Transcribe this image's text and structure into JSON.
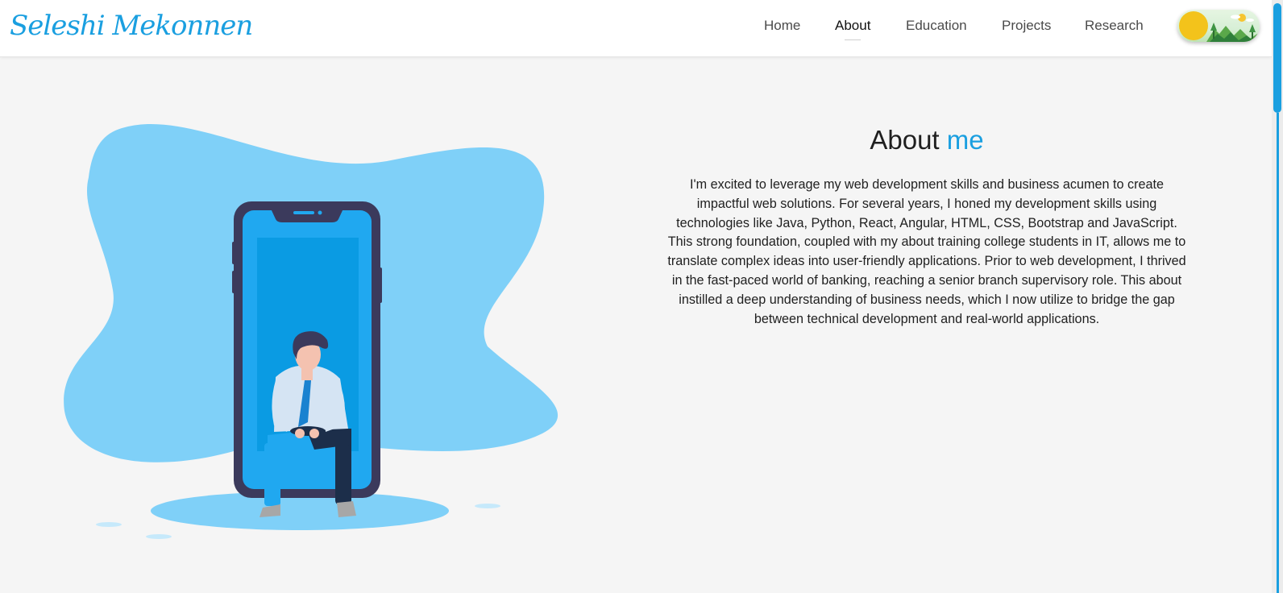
{
  "header": {
    "logo_text": "Seleshi Mekonnen",
    "nav": {
      "home": "Home",
      "about": "About",
      "education": "Education",
      "projects": "Projects",
      "research": "Research"
    }
  },
  "about": {
    "title_main": "About",
    "title_accent": "me",
    "paragraph": "I'm excited to leverage my web development skills and business acumen to create impactful web solutions. For several years, I honed my development skills using technologies like Java, Python, React, Angular, HTML, CSS, Bootstrap and JavaScript. This strong foundation, coupled with my about training college students in IT, allows me to translate complex ideas into user-friendly applications. Prior to web development, I thrived in the fast-paced world of banking, reaching a senior branch supervisory role. This about instilled a deep understanding of business needs, which I now utilize to bridge the gap between technical development and real-world applications."
  },
  "colors": {
    "accent": "#1a9fe0",
    "blob": "#7fd0f8",
    "phone_frame": "#3b3a5c",
    "phone_screen": "#20a8f0",
    "sun": "#f3c31b"
  },
  "icons": {
    "theme_toggle": "sun-landscape-icon"
  }
}
